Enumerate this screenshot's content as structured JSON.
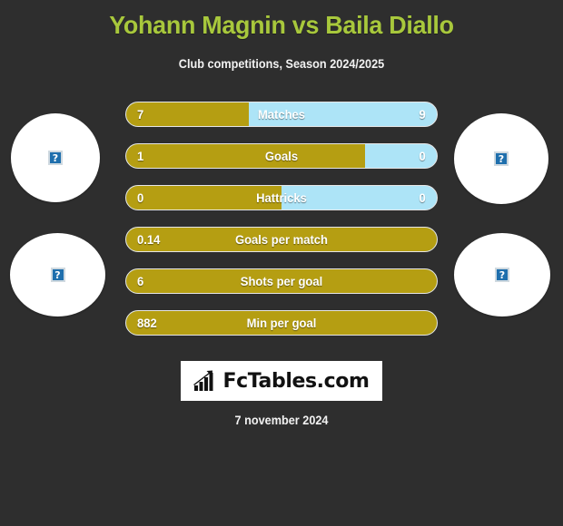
{
  "header": {
    "title": "Yohann Magnin vs Baila Diallo",
    "subtitle": "Club competitions, Season 2024/2025",
    "title_color": "#a8c83c"
  },
  "colors": {
    "background": "#2e2e2e",
    "home_bar": "#b59e12",
    "away_bar": "#ade4f7",
    "text": "#ffffff"
  },
  "avatars": {
    "left_top": {
      "icon": "broken-image-icon",
      "glyph": "?"
    },
    "left_bottom": {
      "icon": "broken-image-icon",
      "glyph": "?"
    },
    "right_top": {
      "icon": "broken-image-icon",
      "glyph": "?"
    },
    "right_bottom": {
      "icon": "broken-image-icon",
      "glyph": "?"
    }
  },
  "chart_data": {
    "type": "bar",
    "title": "Yohann Magnin vs Baila Diallo",
    "subtitle": "Club competitions, Season 2024/2025",
    "orientation": "horizontal-diverging",
    "series": [
      {
        "name": "Yohann Magnin",
        "color": "#b59e12",
        "values": [
          "7",
          "1",
          "0",
          "0.14",
          "6",
          "882"
        ]
      },
      {
        "name": "Baila Diallo",
        "color": "#ade4f7",
        "values": [
          "9",
          "0",
          "0",
          "",
          "",
          ""
        ]
      }
    ],
    "categories": [
      "Matches",
      "Goals",
      "Hattricks",
      "Goals per match",
      "Shots per goal",
      "Min per goal"
    ],
    "xlabel": "",
    "ylabel": "",
    "grid": false,
    "legend": "none"
  },
  "rows": [
    {
      "label": "Matches",
      "left": "7",
      "right": "9",
      "fill_pct": 39.5,
      "show_right": true
    },
    {
      "label": "Goals",
      "left": "1",
      "right": "0",
      "fill_pct": 77.0,
      "show_right": true
    },
    {
      "label": "Hattricks",
      "left": "0",
      "right": "0",
      "fill_pct": 50.0,
      "show_right": true
    },
    {
      "label": "Goals per match",
      "left": "0.14",
      "right": "",
      "fill_pct": 100.0,
      "show_right": false
    },
    {
      "label": "Shots per goal",
      "left": "6",
      "right": "",
      "fill_pct": 100.0,
      "show_right": false
    },
    {
      "label": "Min per goal",
      "left": "882",
      "right": "",
      "fill_pct": 100.0,
      "show_right": false
    }
  ],
  "footer": {
    "logo_text": "FcTables.com",
    "logo_icon": "bar-chart-growth-icon",
    "date": "7 november 2024"
  }
}
